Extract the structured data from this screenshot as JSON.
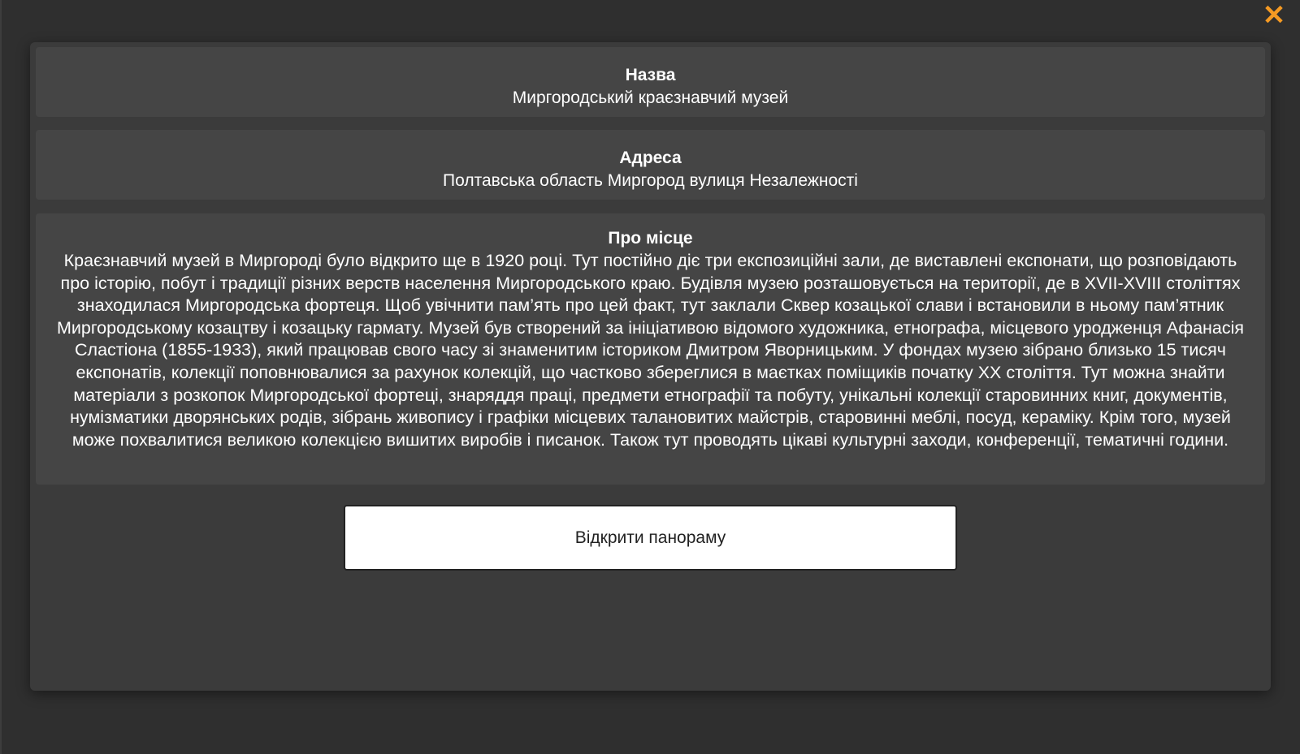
{
  "close": {
    "icon": "close-icon",
    "glyph": "✕",
    "color": "#f59a23"
  },
  "name": {
    "title": "Назва",
    "value": "Миргородський краєзнавчий музей"
  },
  "address": {
    "title": "Адреса",
    "value": "Полтавська область Миргород вулиця Незалежності"
  },
  "about": {
    "title": "Про місце",
    "text": "Краєзнавчий музей в Миргороді було відкрито ще в 1920 році. Тут постійно діє три експозиційні зали, де виставлені експонати, що розповідають про історію, побут і традиції різних верств населення Миргородського краю. Будівля музею розташовується на території, де в XVII-XVIII століттях знаходилася Миргородська фортеця. Щоб увічнити пам’ять про цей факт, тут заклали Сквер козацької слави і встановили в ньому пам’ятник Миргородському козацтву і козацьку гармату. Музей був створений за ініціативою відомого художника, етнографа, місцевого уродженця Афанасія Сластіона (1855-1933), який працював свого часу зі знаменитим істориком Дмитром Яворницьким. У фондах музею зібрано близько 15 тисяч експонатів, колекції поповнювалися за рахунок колекцій, що частково збереглися в маєтках поміщиків початку XX століття. Тут можна знайти матеріали з розкопок Миргородської фортеці, знаряддя праці, предмети етнографії та побуту, унікальні колекції старовинних книг, документів, нумізматики дворянських родів, зібрань живопису і графіки місцевих талановитих майстрів, старовинні меблі, посуд, кераміку. Крім того, музей може похвалитися великою колекцією вишитих виробів і писанок. Також тут проводять цікаві культурні заходи, конференції, тематичні години."
  },
  "panorama_button": {
    "label": "Відкрити панораму"
  }
}
